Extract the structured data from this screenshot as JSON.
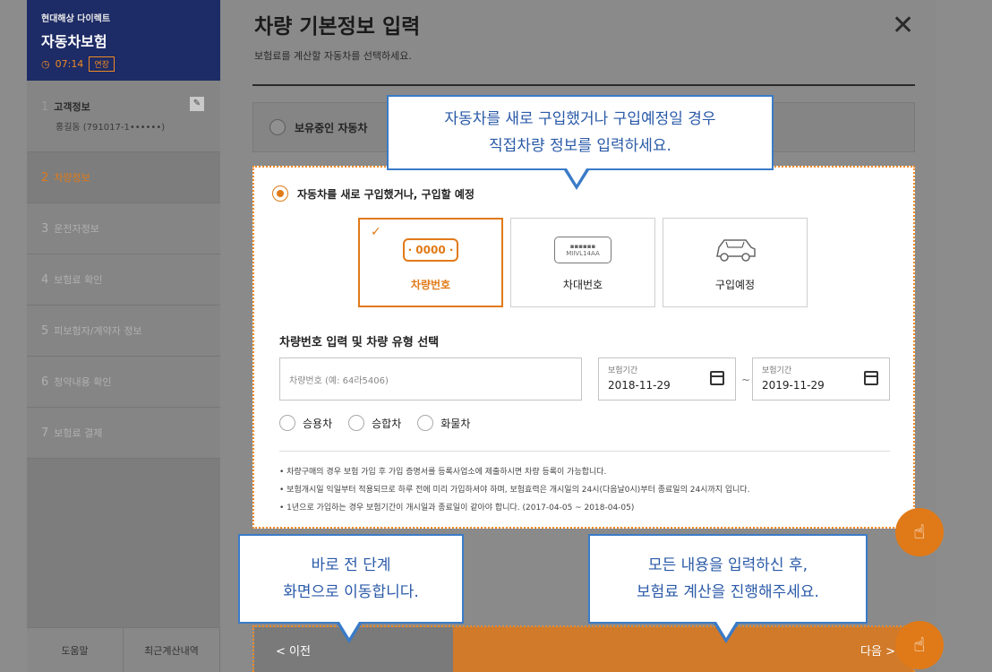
{
  "sidebar": {
    "brand_sub": "현대해상 다이렉트",
    "brand_title": "자동차보험",
    "timer": "07:14",
    "extend_label": "연장",
    "steps": [
      {
        "num": "1",
        "label": "고객정보",
        "sub": "홍길동 (791017-1••••••)"
      },
      {
        "num": "2",
        "label": "차량정보"
      },
      {
        "num": "3",
        "label": "운전자정보"
      },
      {
        "num": "4",
        "label": "보험료 확인"
      },
      {
        "num": "5",
        "label": "피보험자/계약자 정보"
      },
      {
        "num": "6",
        "label": "청약내용 확인"
      },
      {
        "num": "7",
        "label": "보험료 결제"
      }
    ],
    "footer": {
      "help": "도움말",
      "recent": "최근계산내역"
    }
  },
  "main": {
    "title": "차량 기본정보 입력",
    "subtitle": "보험료를 계산할 자동차를 선택하세요.",
    "owned_label": "보유중인 자동차",
    "new_label": "자동차를 새로 구입했거나, 구입할 예정",
    "cards": [
      {
        "label": "차량번호",
        "icon_text": "· 0000 ·"
      },
      {
        "label": "차대번호",
        "icon_text": "MIIVL14AA"
      },
      {
        "label": "구입예정"
      }
    ],
    "section_title": "차량번호 입력 및 차량 유형 선택",
    "plate_placeholder": "차량번호 (예: 64라5406)",
    "date_from": {
      "label": "보험기간",
      "value": "2018-11-29"
    },
    "date_to": {
      "label": "보험기간",
      "value": "2019-11-29"
    },
    "tilde": "~",
    "types": [
      "승용차",
      "승합차",
      "화물차"
    ],
    "notes": [
      "• 차량구매의 경우 보험 가입 후 가입 증명서를 등록사업소에 제출하시면 차량 등록이 가능합니다.",
      "• 보험개시일 익일부터 적용되므로 하루 전에 미리 가입하셔야 하며, 보험효력은 개시일의 24시(다음날0시)부터 종료일의 24시까지 입니다.",
      "• 1년으로 가입하는 경우 보험기간이 개시일과 종료일이 같아야 합니다. (2017-04-05 ~ 2018-04-05)"
    ],
    "prev_label": "< 이전",
    "next_label": "다음 >"
  },
  "tooltips": {
    "top": [
      "자동차를 새로 구입했거나 구입예정일 경우",
      "직접차량 정보를 입력하세요."
    ],
    "left": [
      "바로 전 단계",
      "화면으로 이동합니다."
    ],
    "right": [
      "모든 내용을 입력하신 후,",
      "보험료 계산을 진행해주세요."
    ]
  },
  "colors": {
    "accent": "#e07a18",
    "brand": "#1d2b66",
    "tooltip": "#3a7bc8"
  }
}
